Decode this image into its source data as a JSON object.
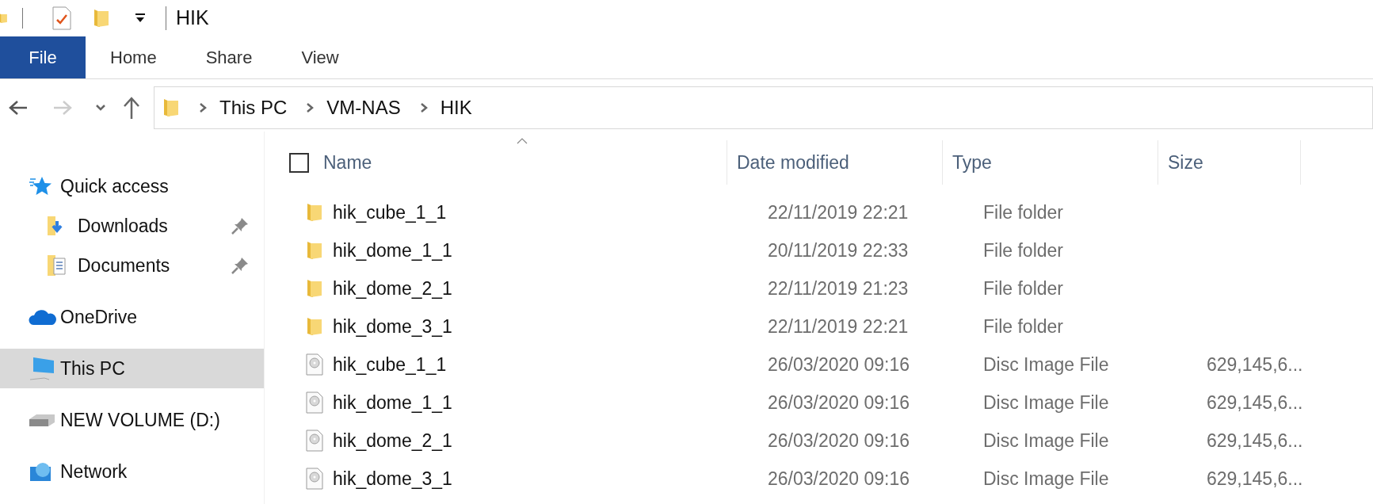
{
  "window": {
    "title": "HIK"
  },
  "ribbon_tabs": [
    {
      "label": "File",
      "selected": true
    },
    {
      "label": "Home",
      "selected": false
    },
    {
      "label": "Share",
      "selected": false
    },
    {
      "label": "View",
      "selected": false
    }
  ],
  "breadcrumb": [
    "This PC",
    "VM-NAS",
    "HIK"
  ],
  "navigation": {
    "back_disabled": false,
    "forward_disabled": true
  },
  "sidebar": {
    "items": [
      {
        "label": "Quick access",
        "kind": "star",
        "pinned": false,
        "selected": false,
        "indent": false
      },
      {
        "label": "Downloads",
        "kind": "downloads",
        "pinned": true,
        "selected": false,
        "indent": true
      },
      {
        "label": "Documents",
        "kind": "documents",
        "pinned": true,
        "selected": false,
        "indent": true
      },
      {
        "label": "OneDrive",
        "kind": "cloud",
        "pinned": false,
        "selected": false,
        "indent": false
      },
      {
        "label": "This PC",
        "kind": "pc",
        "pinned": false,
        "selected": true,
        "indent": false
      },
      {
        "label": "NEW VOLUME (D:)",
        "kind": "drive",
        "pinned": false,
        "selected": false,
        "indent": false
      },
      {
        "label": "Network",
        "kind": "network",
        "pinned": false,
        "selected": false,
        "indent": false
      }
    ]
  },
  "table": {
    "select_all_checked": false,
    "columns": [
      "Name",
      "Date modified",
      "Type",
      "Size"
    ],
    "rows": [
      {
        "kind": "folder",
        "name": "hik_cube_1_1",
        "date": "22/11/2019 22:21",
        "type": "File folder"
      },
      {
        "kind": "folder",
        "name": "hik_dome_1_1",
        "date": "20/11/2019 22:33",
        "type": "File folder"
      },
      {
        "kind": "folder",
        "name": "hik_dome_2_1",
        "date": "22/11/2019 21:23",
        "type": "File folder"
      },
      {
        "kind": "folder",
        "name": "hik_dome_3_1",
        "date": "22/11/2019 22:21",
        "type": "File folder"
      },
      {
        "kind": "disc",
        "name": "hik_cube_1_1",
        "date": "26/03/2020 09:16",
        "type": "Disc Image File",
        "size": "629,145,6..."
      },
      {
        "kind": "disc",
        "name": "hik_dome_1_1",
        "date": "26/03/2020 09:16",
        "type": "Disc Image File",
        "size": "629,145,6..."
      },
      {
        "kind": "disc",
        "name": "hik_dome_2_1",
        "date": "26/03/2020 09:16",
        "type": "Disc Image File",
        "size": "629,145,6..."
      },
      {
        "kind": "disc",
        "name": "hik_dome_3_1",
        "date": "26/03/2020 09:16",
        "type": "Disc Image File",
        "size": "629,145,6..."
      }
    ]
  }
}
